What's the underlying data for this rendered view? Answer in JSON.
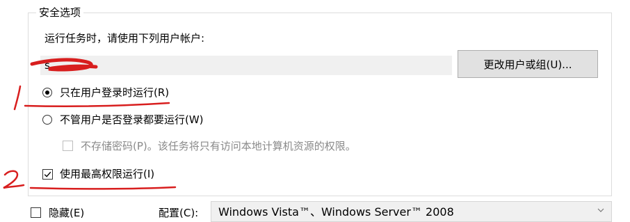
{
  "security": {
    "legend": "安全选项",
    "run_as_label": "运行任务时，请使用下列用户帐户:",
    "user_account": "s",
    "change_user_button": "更改用户或组(U)...",
    "radio_logged_on": "只在用户登录时运行(R)",
    "radio_any": "不管用户是否登录都要运行(W)",
    "no_store_password": "不存储密码(P)。该任务将只有访问本地计算机资源的权限。",
    "highest_privileges": "使用最高权限运行(I)"
  },
  "bottom": {
    "hidden_label": "隐藏(E)",
    "configure_label": "配置(C):",
    "configure_value": "Windows Vista™、Windows Server™ 2008"
  },
  "state": {
    "radio_logged_on_selected": true,
    "radio_any_selected": false,
    "no_store_password_checked": false,
    "highest_privileges_checked": true,
    "hidden_checked": false
  },
  "annotations": {
    "marks": [
      "1",
      "2"
    ],
    "ink_color": "#d81e1e"
  },
  "colors": {
    "button_bg": "#e1e1e1",
    "field_bg": "#f0f0f0",
    "disabled_text": "#8a8a8a"
  }
}
